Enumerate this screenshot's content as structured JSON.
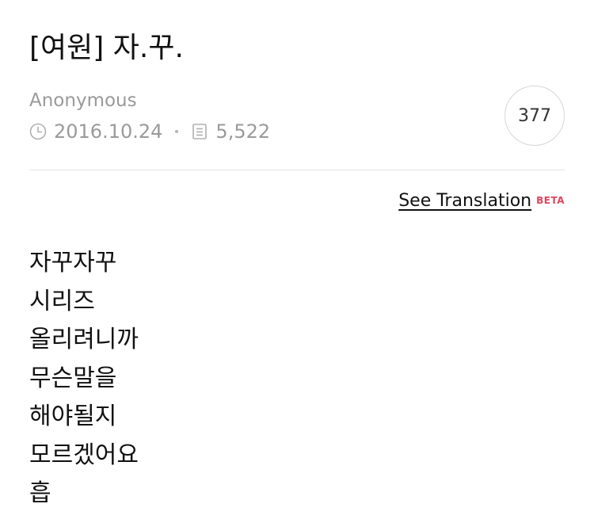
{
  "post": {
    "title": "[여원] 자.꾸.",
    "author": "Anonymous",
    "date": "2016.10.24",
    "views": "5,522",
    "comment_count": "377",
    "date_icon": "clock-icon",
    "views_icon": "document-icon"
  },
  "translation": {
    "link_label": "See Translation",
    "badge": "BETA",
    "badge_color": "#e0465b"
  },
  "body": {
    "lines": [
      "자꾸자꾸",
      "시리즈",
      "올리려니까",
      "무슨말을",
      "해야될지",
      "모르겠어요",
      "흡"
    ]
  }
}
